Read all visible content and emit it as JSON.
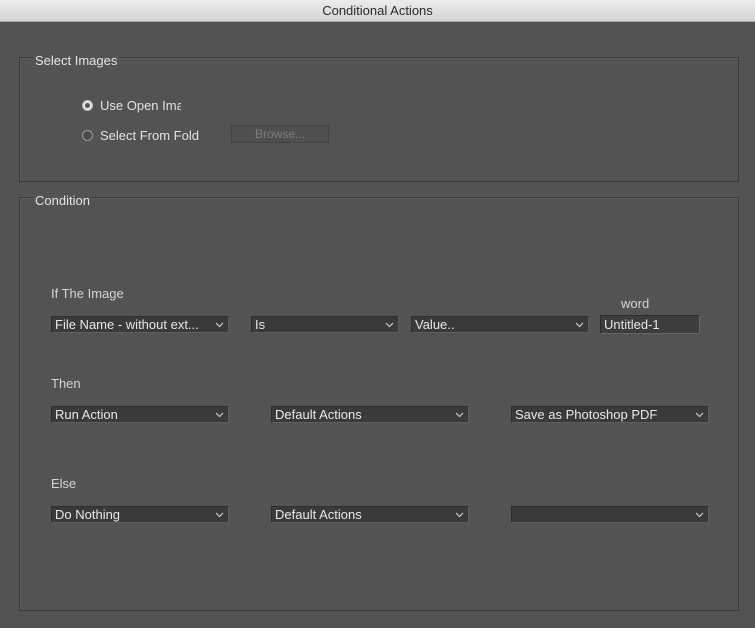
{
  "window": {
    "title": "Conditional Actions"
  },
  "select_images": {
    "title": "Select Images",
    "use_open_images_label": "Use Open Ima",
    "select_from_folder_label": "Select From Fold",
    "browse_label": "Browse...",
    "selected": "use_open_images"
  },
  "condition": {
    "title": "Condition",
    "if_label": "If The Image",
    "word_label": "word",
    "if_property": "File Name - without ext...",
    "if_operator": "Is",
    "if_value_type": "Value..",
    "if_word_value": "Untitled-1",
    "then_label": "Then",
    "then_action_type": "Run Action",
    "then_action_set": "Default Actions",
    "then_action": "Save as Photoshop PDF",
    "else_label": "Else",
    "else_action_type": "Do Nothing",
    "else_action_set": "Default Actions",
    "else_action": ""
  },
  "colors": {
    "background": "#535353",
    "field": "#3a3a3a",
    "text": "#e8e8e8"
  }
}
